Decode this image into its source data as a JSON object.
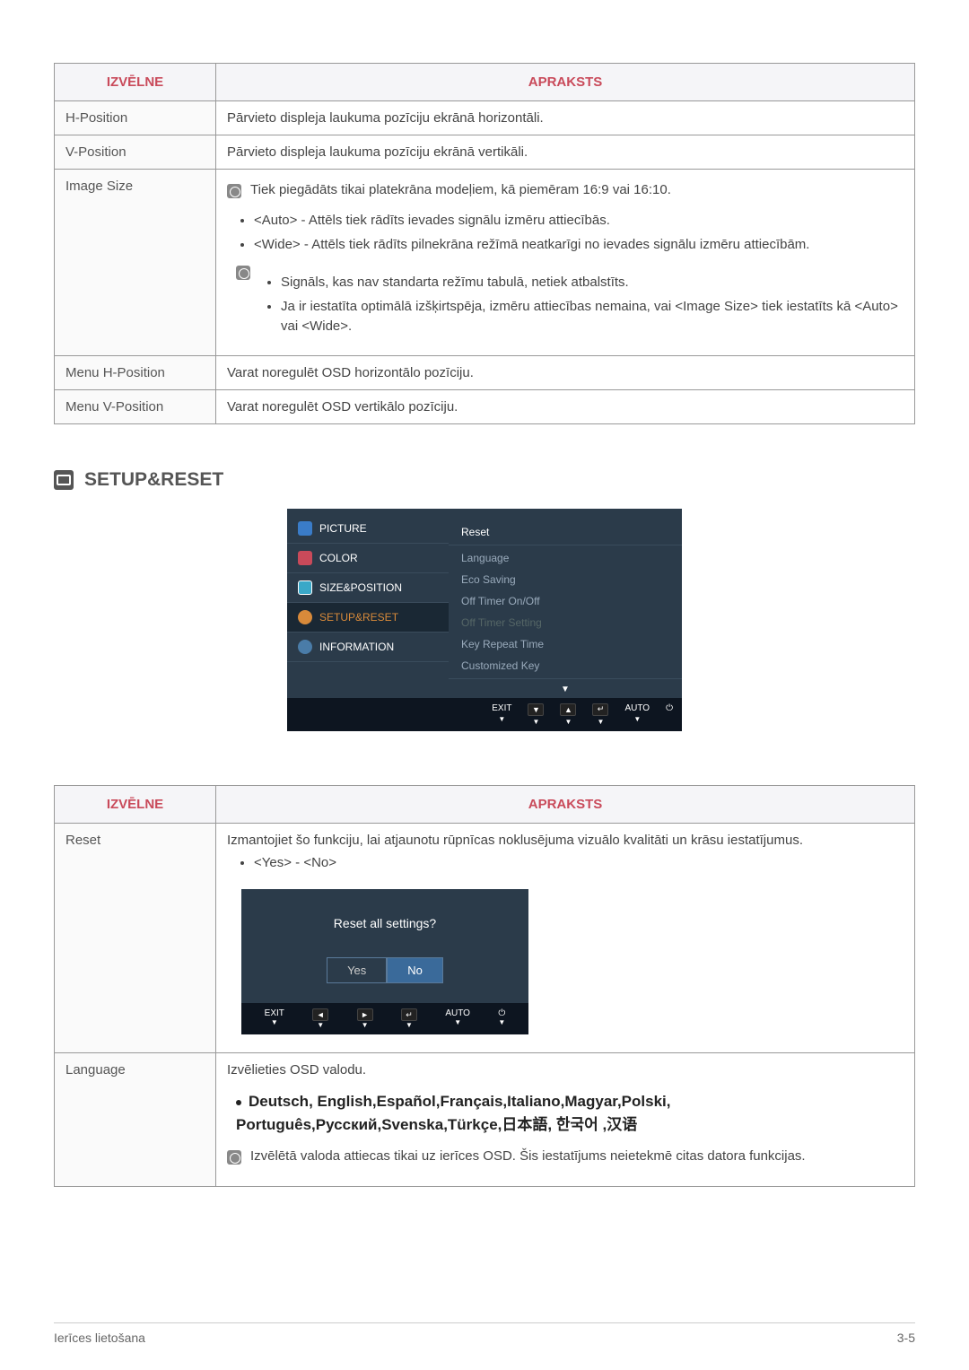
{
  "table1": {
    "headers": {
      "menu": "IZVĒLNE",
      "desc": "APRAKSTS"
    },
    "rows": {
      "hpos": {
        "label": "H-Position",
        "desc": "Pārvieto displeja laukuma pozīciju ekrānā horizontāli."
      },
      "vpos": {
        "label": "V-Position",
        "desc": "Pārvieto displeja laukuma pozīciju ekrānā vertikāli."
      },
      "imagesize": {
        "label": "Image Size",
        "note1": "Tiek piegādāts tikai platekrāna modeļiem, kā piemēram 16:9 vai 16:10.",
        "bullets": [
          "<Auto> - Attēls tiek rādīts ievades signālu izmēru attiecībās.",
          "<Wide> - Attēls tiek rādīts pilnekrāna režīmā neatkarīgi no ievades signālu izmēru attiecībām."
        ],
        "sub_bullets": [
          "Signāls, kas nav standarta režīmu tabulā, netiek atbalstīts.",
          "Ja ir iestatīta optimālā izšķirtspēja, izmēru attiecības nemaina, vai <Image Size> tiek iestatīts kā <Auto> vai <Wide>."
        ]
      },
      "menuhpos": {
        "label": "Menu H-Position",
        "desc": "Varat noregulēt OSD horizontālo pozīciju."
      },
      "menuvpos": {
        "label": "Menu V-Position",
        "desc": "Varat noregulēt OSD vertikālo pozīciju."
      }
    }
  },
  "section_heading": "SETUP&RESET",
  "osd": {
    "left": [
      "PICTURE",
      "COLOR",
      "SIZE&POSITION",
      "SETUP&RESET",
      "INFORMATION"
    ],
    "right": [
      "Reset",
      "Language",
      "Eco Saving",
      "Off Timer On/Off",
      "Off Timer Setting",
      "Key Repeat Time",
      "Customized Key"
    ],
    "bottombar": {
      "exit": "EXIT",
      "auto": "AUTO"
    }
  },
  "table2": {
    "headers": {
      "menu": "IZVĒLNE",
      "desc": "APRAKSTS"
    },
    "rows": {
      "reset": {
        "label": "Reset",
        "desc": "Izmantojiet šo funkciju, lai atjaunotu rūpnīcas noklusējuma vizuālo kvalitāti un krāsu iestatījumus.",
        "option": "<Yes> - <No>",
        "dialog": {
          "title": "Reset all settings?",
          "yes": "Yes",
          "no": "No",
          "exit": "EXIT",
          "auto": "AUTO"
        }
      },
      "language": {
        "label": "Language",
        "desc": "Izvēlieties OSD valodu.",
        "langs": "Deutsch, English,Español,Français,Italiano,Magyar,Polski, Português,Русский,Svenska,Türkçe,日本語, 한국어 ,汉语",
        "note": "Izvēlētā valoda attiecas tikai uz ierīces OSD. Šis iestatījums neietekmē citas datora funkcijas."
      }
    }
  },
  "footer": {
    "left": "Ierīces lietošana",
    "right": "3-5"
  }
}
